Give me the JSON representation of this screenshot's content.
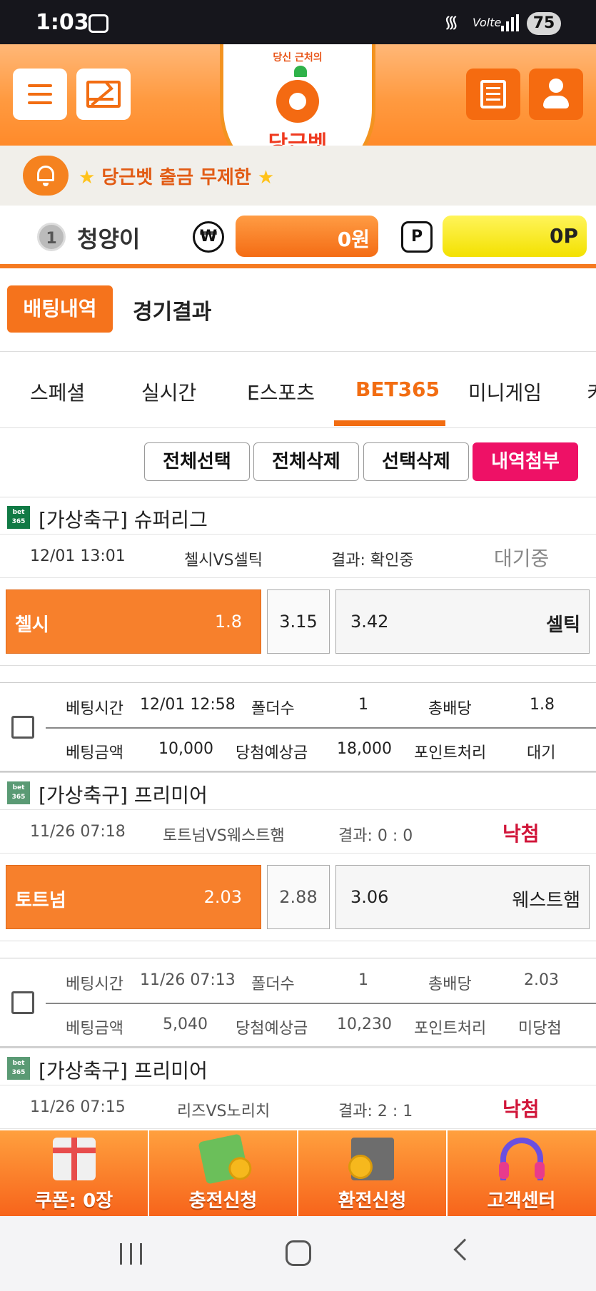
{
  "status_bar": {
    "time": "1:03",
    "network": "Volte",
    "battery": "75"
  },
  "header": {
    "logo_sub": "당신 근처의",
    "logo_name": "당근벳",
    "menu_icon": "hamburger-menu-icon",
    "mail_icon": "envelope-icon",
    "list_icon": "list-icon",
    "user_icon": "user-icon"
  },
  "notice": {
    "star_left": "★",
    "text": "당근벳 출금 무제한",
    "star_right": "★"
  },
  "user": {
    "level": "1",
    "name": "청양이",
    "money_symbol": "₩",
    "money": "0원",
    "point_symbol": "P",
    "points": "0P"
  },
  "page_tabs": {
    "active": "배팅내역",
    "other": "경기결과"
  },
  "category_tabs": [
    "스페셜",
    "실시간",
    "E스포츠",
    "BET365",
    "미니게임",
    "키"
  ],
  "active_category": "BET365",
  "actions": {
    "select_all": "전체선택",
    "delete_all": "전체삭제",
    "delete_selected": "선택삭제",
    "attach": "내역첨부"
  },
  "bets": [
    {
      "provider_badge": "bet 365",
      "league": "[가상축구] 슈퍼리그",
      "match_time": "12/01 13:01",
      "match": "첼시VS셀틱",
      "result": "결과: 확인중",
      "status": "대기중",
      "home_team": "첼시",
      "home_odds": "1.8",
      "draw_odds": "3.15",
      "away_odds": "3.42",
      "away_team": "셀틱",
      "detail": {
        "bet_time_label": "베팅시간",
        "bet_time": "12/01 12:58",
        "folder_label": "폴더수",
        "folder": "1",
        "total_odds_label": "총배당",
        "total_odds": "1.8",
        "amount_label": "베팅금액",
        "amount": "10,000",
        "expected_label": "당첨예상금",
        "expected": "18,000",
        "point_label": "포인트처리",
        "point_status": "대기"
      }
    },
    {
      "provider_badge": "bet 365",
      "league": "[가상축구] 프리미어",
      "match_time": "11/26 07:18",
      "match": "토트넘VS웨스트햄",
      "result": "결과: 0 : 0",
      "status": "낙첨",
      "home_team": "토트넘",
      "home_odds": "2.03",
      "draw_odds": "2.88",
      "away_odds": "3.06",
      "away_team": "웨스트햄",
      "detail": {
        "bet_time_label": "베팅시간",
        "bet_time": "11/26 07:13",
        "folder_label": "폴더수",
        "folder": "1",
        "total_odds_label": "총배당",
        "total_odds": "2.03",
        "amount_label": "베팅금액",
        "amount": "5,040",
        "expected_label": "당첨예상금",
        "expected": "10,230",
        "point_label": "포인트처리",
        "point_status": "미당첨"
      }
    },
    {
      "provider_badge": "bet 365",
      "league": "[가상축구] 프리미어",
      "match_time": "11/26 07:15",
      "match": "리즈VS노리치",
      "result": "결과: 2 : 1",
      "status": "낙첨"
    }
  ],
  "bottom_menu": [
    {
      "label": "쿠폰: 0장",
      "icon": "gift-icon"
    },
    {
      "label": "충전신청",
      "icon": "cash-icon"
    },
    {
      "label": "환전신청",
      "icon": "exchange-doc-icon"
    },
    {
      "label": "고객센터",
      "icon": "headset-icon"
    }
  ],
  "colors": {
    "accent": "#f57a21",
    "pink": "#ee1166",
    "lose": "#d1163a",
    "yellow": "#f3e100"
  }
}
